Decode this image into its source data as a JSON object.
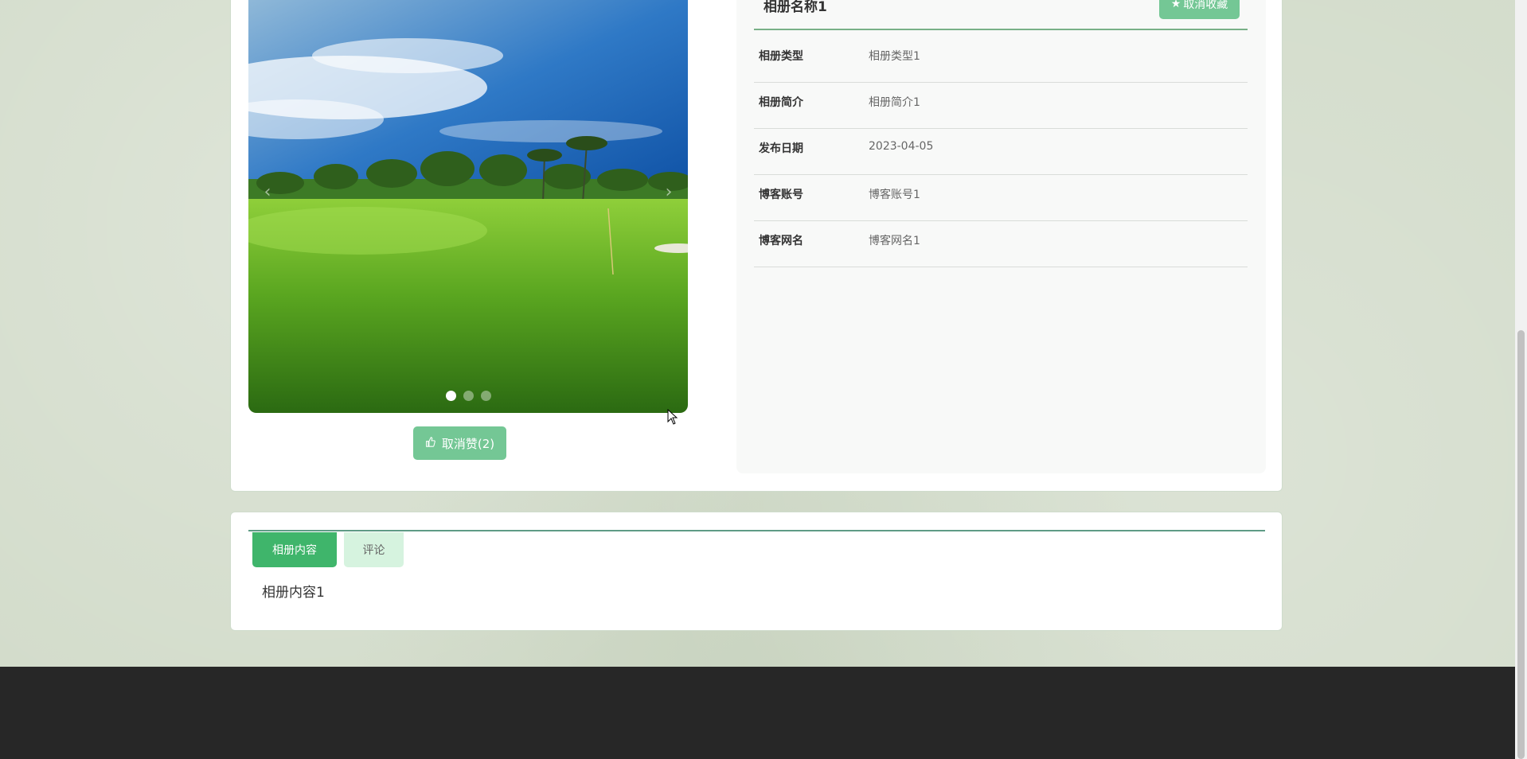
{
  "album": {
    "title": "相册名称1",
    "fav_label": "取消收藏",
    "like_label": "取消赞(2)",
    "fields": [
      {
        "label": "相册类型",
        "value": "相册类型1"
      },
      {
        "label": "相册简介",
        "value": "相册简介1"
      },
      {
        "label": "发布日期",
        "value": "2023-04-05"
      },
      {
        "label": "博客账号",
        "value": "博客账号1"
      },
      {
        "label": "博客网名",
        "value": "博客网名1"
      }
    ]
  },
  "carousel": {
    "slide_count": 3,
    "active_slide": 1,
    "prev": "‹",
    "next": "›"
  },
  "tabs": [
    {
      "label": "相册内容",
      "active": true
    },
    {
      "label": "评论",
      "active": false
    }
  ],
  "content": {
    "text": "相册内容1"
  },
  "icons": {
    "star": "★",
    "thumb": "thumbs-up-icon"
  },
  "colors": {
    "accent": "#3fb56b",
    "button": "#74c795",
    "footer": "#272727"
  }
}
